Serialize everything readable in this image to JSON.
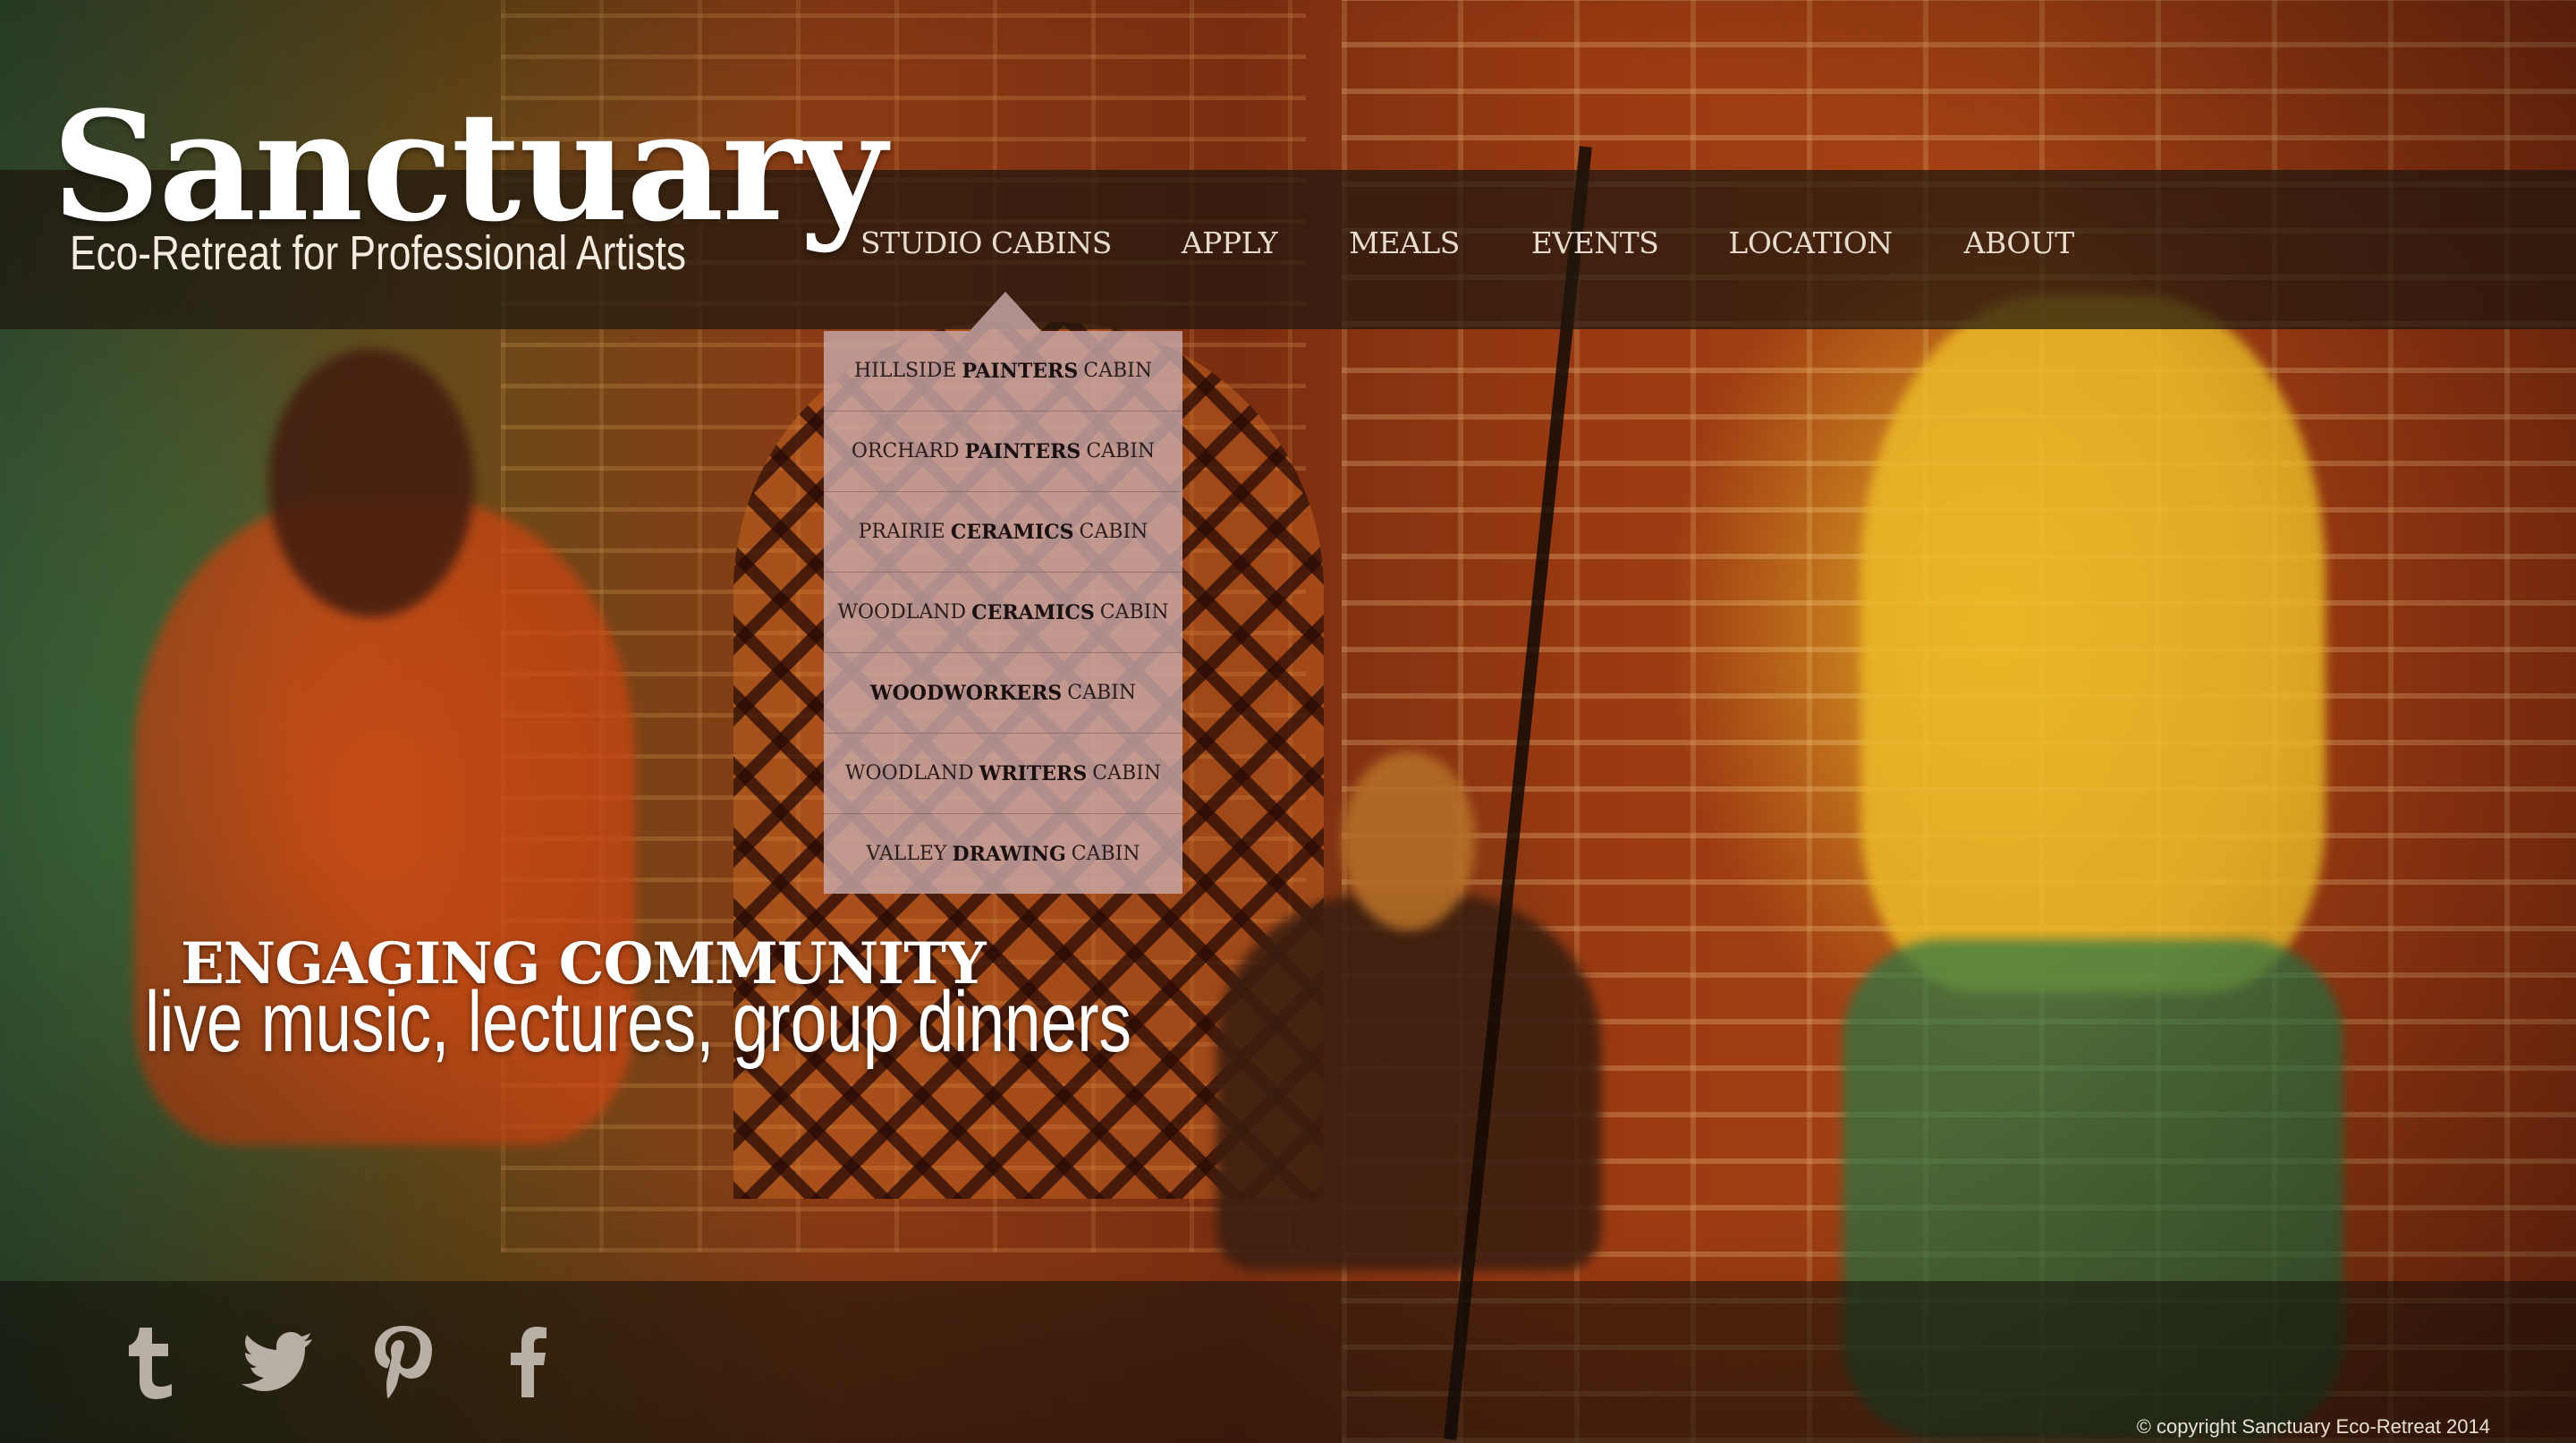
{
  "brand": {
    "title": "Sanctuary",
    "tagline": "Eco-Retreat for Professional Artists"
  },
  "nav": {
    "items": [
      {
        "label": "STUDIO CABINS",
        "active": true
      },
      {
        "label": "APPLY"
      },
      {
        "label": "MEALS"
      },
      {
        "label": "EVENTS"
      },
      {
        "label": "LOCATION"
      },
      {
        "label": "ABOUT"
      }
    ]
  },
  "dropdown": {
    "items": [
      {
        "pre": "HILLSIDE",
        "bold": "PAINTERS",
        "post": "CABIN"
      },
      {
        "pre": "ORCHARD",
        "bold": "PAINTERS",
        "post": "CABIN"
      },
      {
        "pre": "PRAIRIE",
        "bold": "CERAMICS",
        "post": "CABIN"
      },
      {
        "pre": "WOODLAND",
        "bold": "CERAMICS",
        "post": "CABIN"
      },
      {
        "pre": "",
        "bold": "WOODWORKERS",
        "post": "CABIN"
      },
      {
        "pre": "WOODLAND",
        "bold": "WRITERS",
        "post": "CABIN"
      },
      {
        "pre": "VALLEY",
        "bold": "DRAWING",
        "post": "CABIN"
      }
    ]
  },
  "hero": {
    "heading": "ENGAGING COMMUNITY",
    "subheading": "live music, lectures, group dinners"
  },
  "footer": {
    "social": [
      {
        "icon": "tumblr-icon"
      },
      {
        "icon": "twitter-icon"
      },
      {
        "icon": "pinterest-icon"
      },
      {
        "icon": "facebook-icon"
      }
    ],
    "copyright": "© copyright Sanctuary Eco-Retreat 2014"
  },
  "colors": {
    "header_bar": "#1e160e",
    "dropdown_bg": "#c8a8a8",
    "nav_text": "#e7dccd",
    "social_icon": "#b8b0a6"
  }
}
